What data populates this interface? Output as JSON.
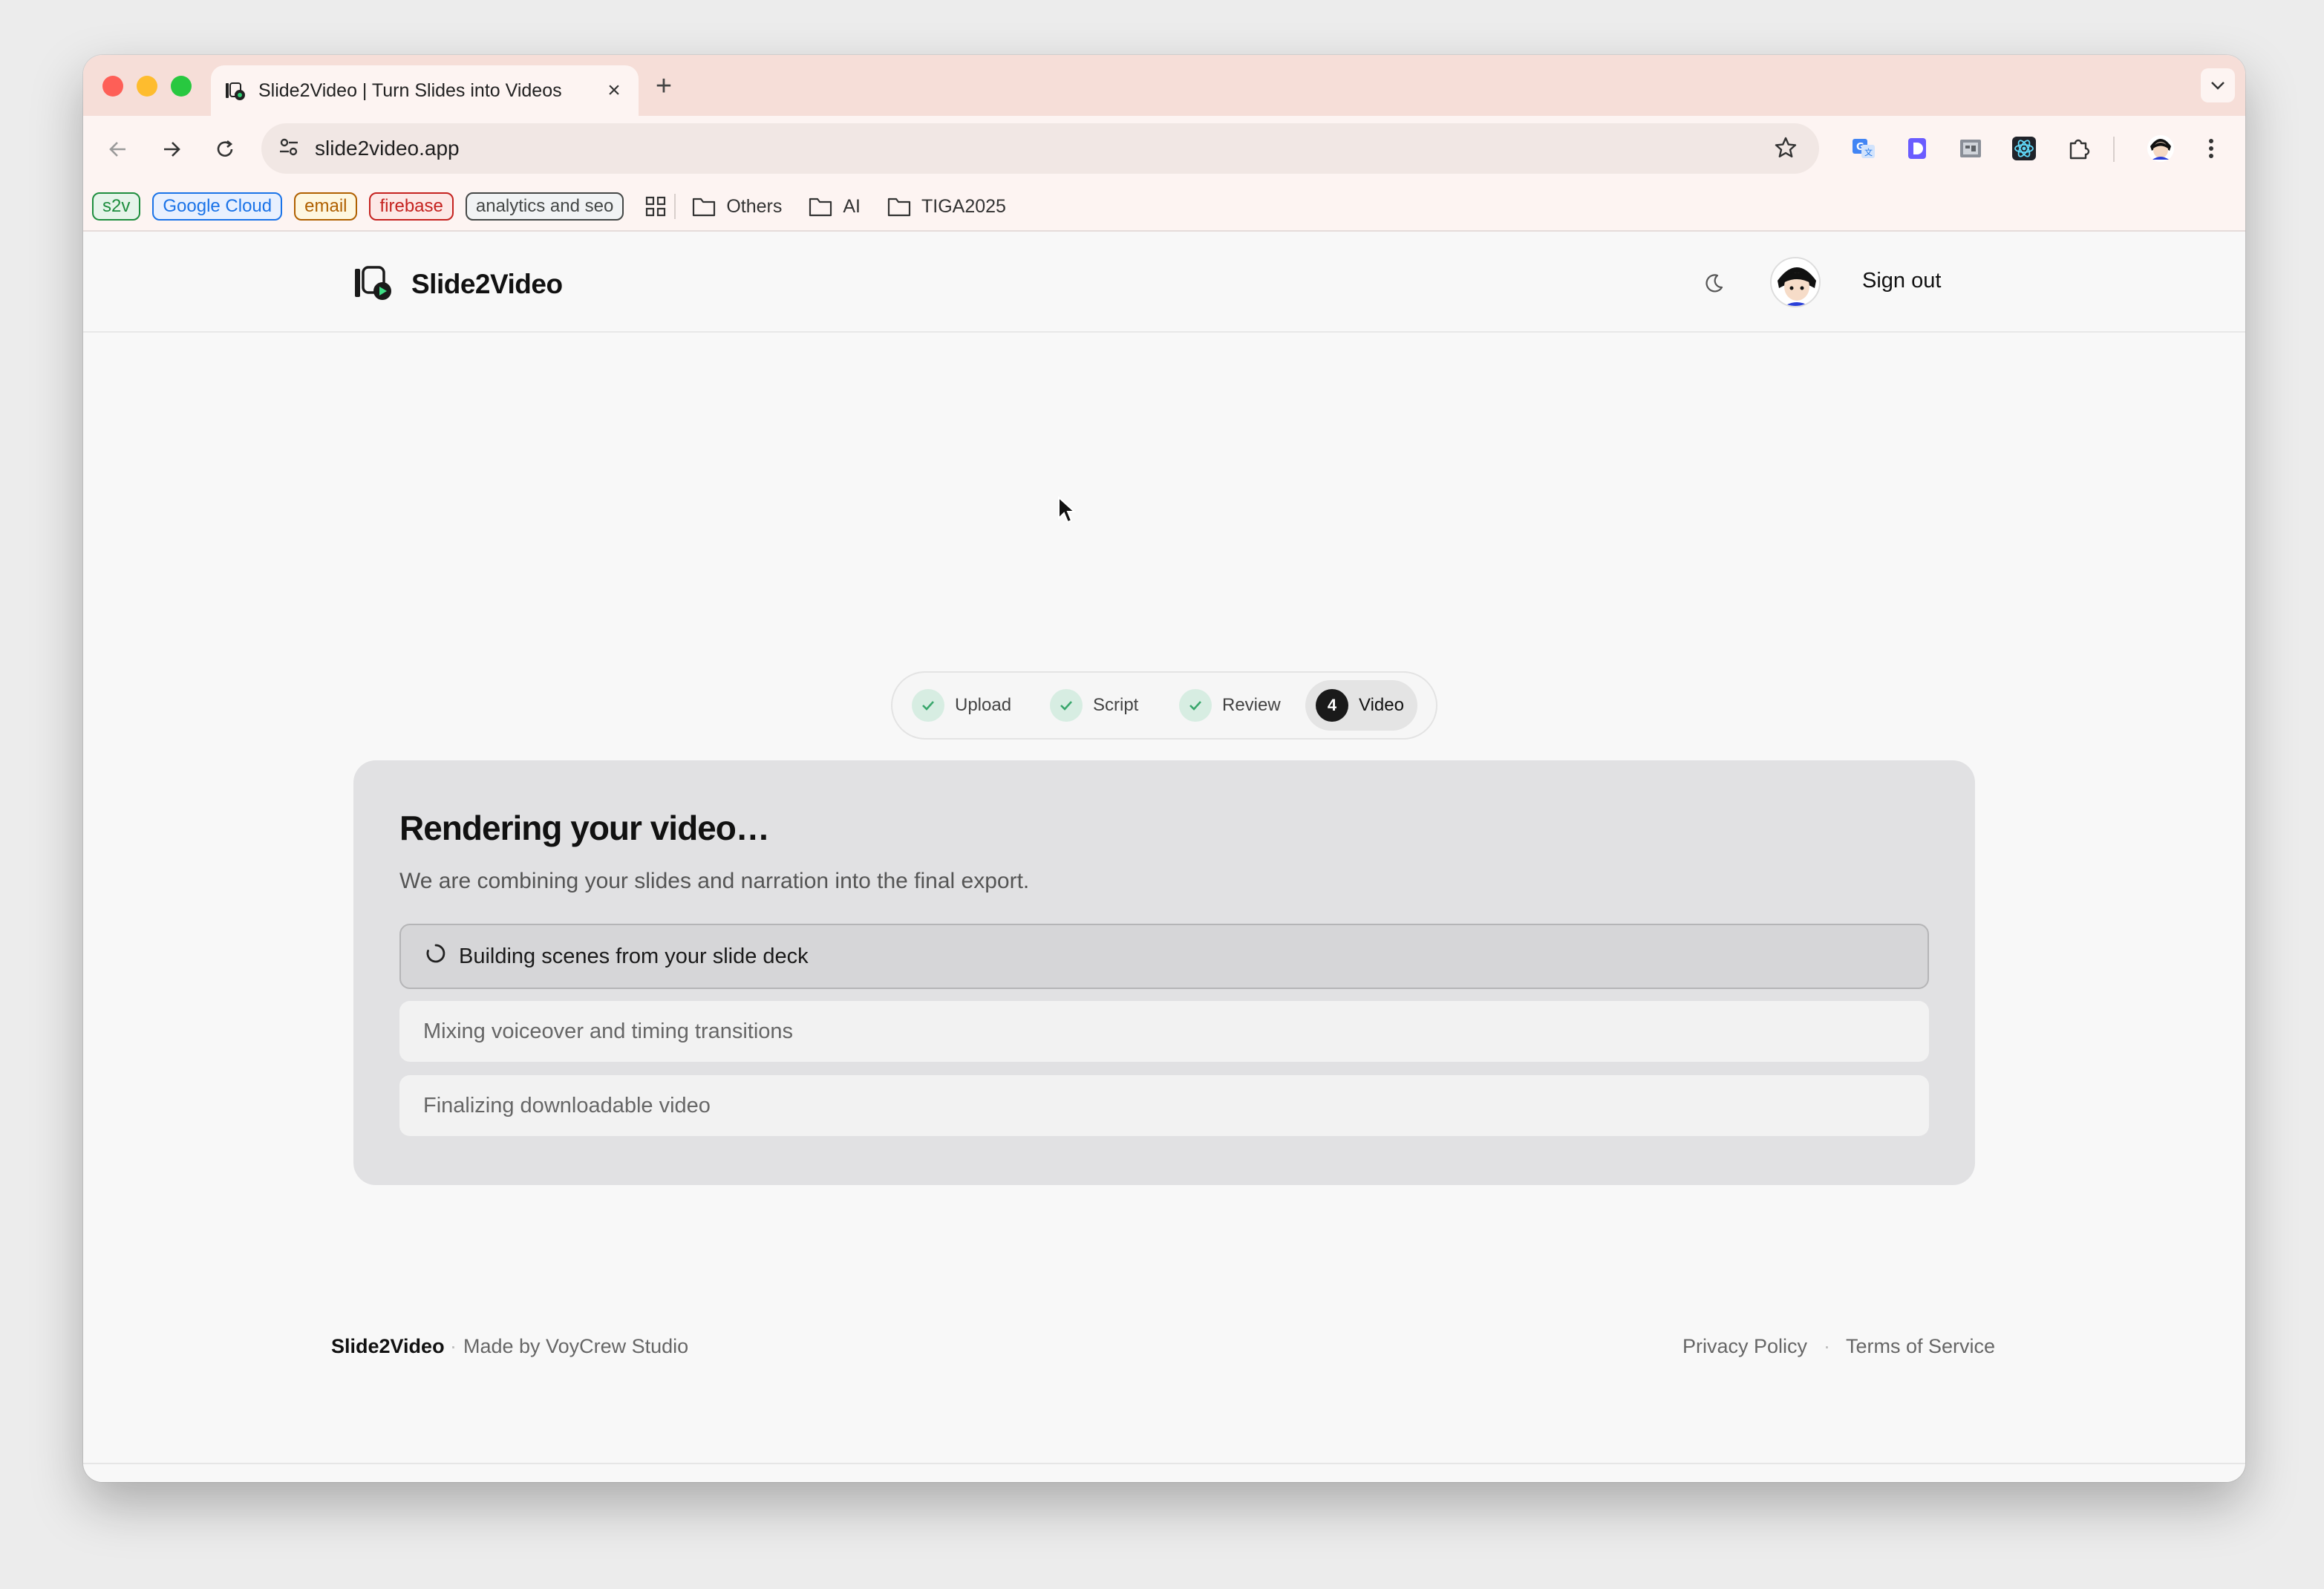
{
  "browser": {
    "tab_title": "Slide2Video | Turn Slides into Videos",
    "url": "slide2video.app",
    "bookmarks": [
      {
        "label": "s2v",
        "color": "#1e8e3e",
        "bg": "#e6f4ea"
      },
      {
        "label": "Google Cloud",
        "color": "#1a73e8",
        "bg": "#e8f0fe"
      },
      {
        "label": "email",
        "color": "#b06000",
        "bg": "#fef7e0"
      },
      {
        "label": "firebase",
        "color": "#c5221f",
        "bg": "#fce8e6"
      },
      {
        "label": "analytics and seo",
        "color": "#444746",
        "bg": "#f1f3f4"
      }
    ],
    "folders": [
      "Others",
      "AI",
      "TIGA2025"
    ]
  },
  "header": {
    "brand": "Slide2Video",
    "sign_out": "Sign out"
  },
  "stepper": {
    "steps": [
      {
        "label": "Upload",
        "state": "done"
      },
      {
        "label": "Script",
        "state": "done"
      },
      {
        "label": "Review",
        "state": "done"
      },
      {
        "label": "Video",
        "state": "active",
        "number": "4"
      }
    ]
  },
  "render": {
    "title": "Rendering your video…",
    "subtitle": "We are combining your slides and narration into the final export.",
    "tasks": [
      {
        "label": "Building scenes from your slide deck",
        "state": "in-progress"
      },
      {
        "label": "Mixing voiceover and timing transitions",
        "state": "pending"
      },
      {
        "label": "Finalizing downloadable video",
        "state": "pending"
      }
    ]
  },
  "footer": {
    "brand": "Slide2Video",
    "made_by": "Made by VoyCrew Studio",
    "privacy": "Privacy Policy",
    "terms": "Terms of Service"
  }
}
